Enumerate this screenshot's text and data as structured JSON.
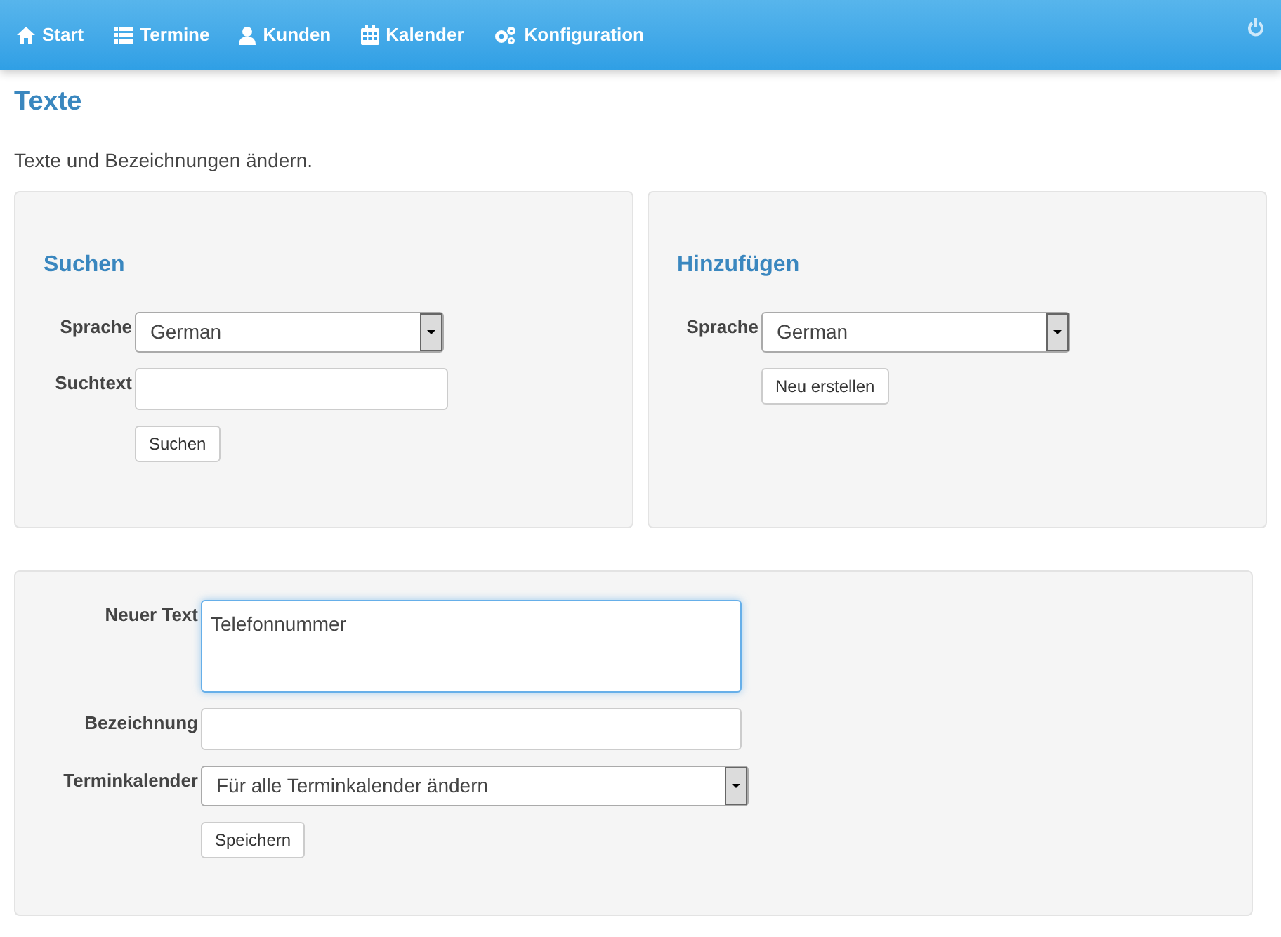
{
  "nav": {
    "items": [
      {
        "label": "Start",
        "kind": "house"
      },
      {
        "label": "Termine",
        "kind": "list"
      },
      {
        "label": "Kunden",
        "kind": "user"
      },
      {
        "label": "Kalender",
        "kind": "calendar"
      },
      {
        "label": "Konfiguration",
        "kind": "gears"
      }
    ]
  },
  "page": {
    "title": "Texte",
    "description": "Texte und Bezeichnungen ändern."
  },
  "panels": [
    {
      "title": "Suchen",
      "fields": [
        {
          "kind": "select",
          "label": "Sprache",
          "value": "German"
        },
        {
          "kind": "text",
          "label": "Suchtext"
        }
      ],
      "button": "Suchen"
    },
    {
      "title": "Hinzufügen",
      "fields": [
        {
          "kind": "select",
          "label": "Sprache",
          "value": "German"
        }
      ],
      "button": "Neu erstellen"
    }
  ],
  "edit_form": {
    "fields": [
      {
        "kind": "textarea",
        "label": "Neuer Text",
        "value": "Telefonnummer",
        "focused": true
      },
      {
        "kind": "text",
        "label": "Bezeichnung",
        "focused": false
      },
      {
        "kind": "select",
        "label": "Terminkalender",
        "value": "Für alle Terminkalender ändern",
        "focused": false
      }
    ],
    "button": "Speichern"
  }
}
